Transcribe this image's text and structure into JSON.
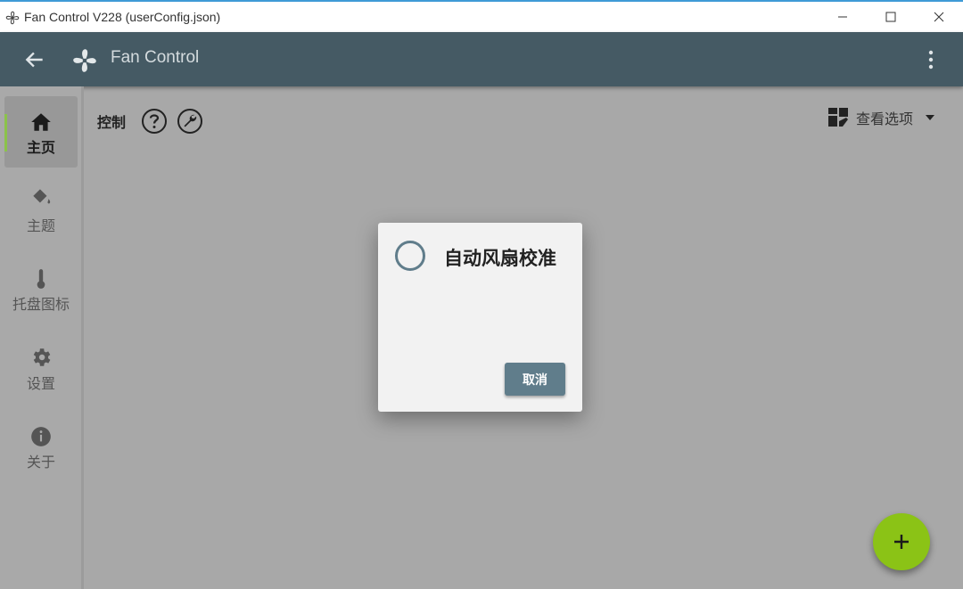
{
  "window": {
    "title": "Fan Control V228 (userConfig.json)"
  },
  "appbar": {
    "title": "Fan Control"
  },
  "sidebar": {
    "items": [
      {
        "label": "主页",
        "icon": "home-icon",
        "active": true
      },
      {
        "label": "主题",
        "icon": "paint-bucket-icon",
        "active": false
      },
      {
        "label": "托盘图标",
        "icon": "thermometer-icon",
        "active": false
      },
      {
        "label": "设置",
        "icon": "gear-icon",
        "active": false
      },
      {
        "label": "关于",
        "icon": "info-icon",
        "active": false
      }
    ]
  },
  "main": {
    "section_label": "控制",
    "view_options_label": "查看选项"
  },
  "dialog": {
    "title": "自动风扇校准",
    "cancel_label": "取消"
  },
  "colors": {
    "appbar": "#455a64",
    "accent_green": "#8bc34a",
    "button_blue_grey": "#607d8b"
  }
}
